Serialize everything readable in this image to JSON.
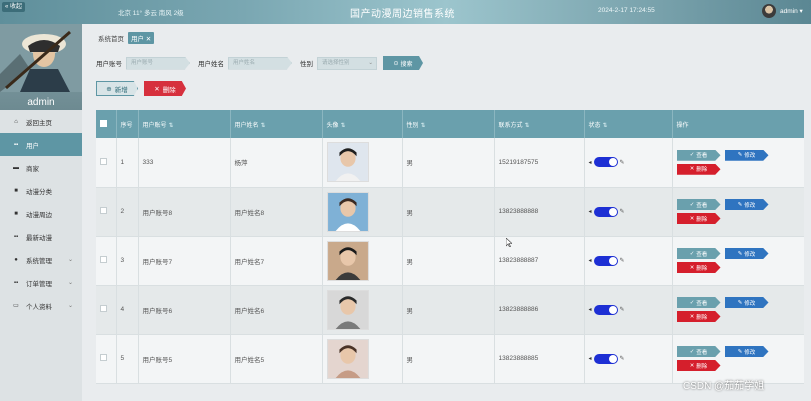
{
  "header": {
    "collapse_label": "« 收起",
    "weather": "北京  11°  多云  南风  2级",
    "title": "国产动漫周边销售系统",
    "datetime": "2024-2-17  17:24:55",
    "user": "admin ▾"
  },
  "sidebar": {
    "profile_name": "admin",
    "items": [
      {
        "label": "返回主页",
        "icon": "home-icon"
      },
      {
        "label": "用户",
        "icon": "grid-icon"
      },
      {
        "label": "商家",
        "icon": "shop-icon"
      },
      {
        "label": "动漫分类",
        "icon": "tag-icon"
      },
      {
        "label": "动漫周边",
        "icon": "box-icon"
      },
      {
        "label": "最新动漫",
        "icon": "grid-icon"
      },
      {
        "label": "系统管理",
        "icon": "settings-icon"
      },
      {
        "label": "订单管理",
        "icon": "grid-icon"
      },
      {
        "label": "个人资料",
        "icon": "profile-icon"
      }
    ]
  },
  "breadcrumb": {
    "home": "系统首页",
    "current": "用户 ✕"
  },
  "search": {
    "account_label": "用户账号",
    "account_placeholder": "用户账号",
    "name_label": "用户姓名",
    "name_placeholder": "用户姓名",
    "gender_label": "性别",
    "gender_placeholder": "请选择性别",
    "search_button": "搜索"
  },
  "actions": {
    "add": "新增",
    "delete": "删除"
  },
  "table": {
    "headers": [
      "序号",
      "用户账号",
      "用户姓名",
      "头像",
      "性别",
      "联系方式",
      "状态",
      "操作"
    ],
    "rows": [
      {
        "index": "1",
        "account": "333",
        "name": "杨萍",
        "gender": "男",
        "phone": "15219187575"
      },
      {
        "index": "2",
        "account": "用户账号8",
        "name": "用户姓名8",
        "gender": "男",
        "phone": "13823888888"
      },
      {
        "index": "3",
        "account": "用户账号7",
        "name": "用户姓名7",
        "gender": "男",
        "phone": "13823888887"
      },
      {
        "index": "4",
        "account": "用户账号6",
        "name": "用户姓名6",
        "gender": "男",
        "phone": "13823888886"
      },
      {
        "index": "5",
        "account": "用户账号5",
        "name": "用户姓名5",
        "gender": "男",
        "phone": "13823888885"
      }
    ],
    "btn_view": "查看",
    "btn_edit": "修改",
    "btn_delete": "删除"
  },
  "watermark": "CSDN @茄茄学姐",
  "colors": {
    "accent": "#5e96a4",
    "danger": "#d6303d",
    "edit": "#2f74c0",
    "toggle": "#1d2fd4"
  }
}
